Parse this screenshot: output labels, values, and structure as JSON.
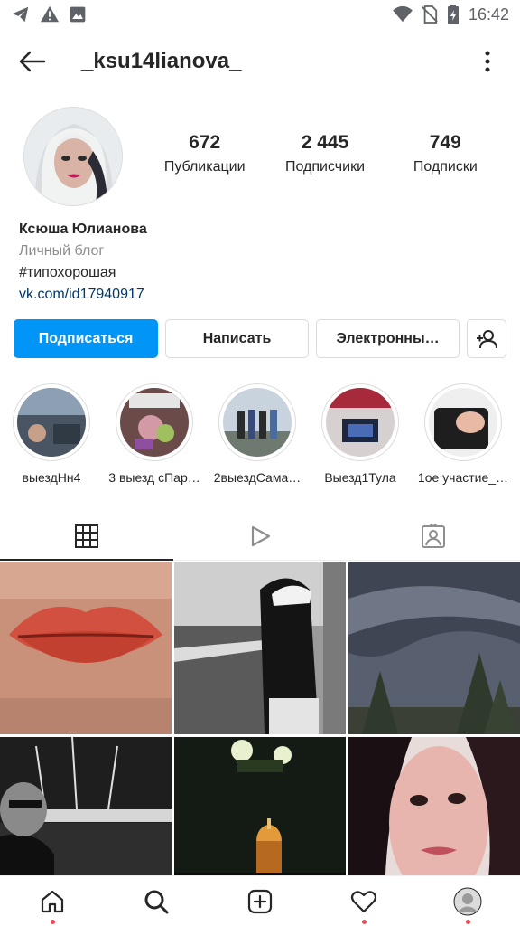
{
  "status_bar": {
    "time": "16:42",
    "left_icons": [
      "telegram-icon",
      "warning-icon",
      "image-icon"
    ],
    "right_icons": [
      "wifi-icon",
      "no-sim-icon",
      "battery-icon"
    ]
  },
  "header": {
    "username": "_ksu14lianova_"
  },
  "stats": [
    {
      "value": "672",
      "label": "Публикации"
    },
    {
      "value": "2 445",
      "label": "Подписчики"
    },
    {
      "value": "749",
      "label": "Подписки"
    }
  ],
  "bio": {
    "name": "Ксюша Юлианова",
    "category": "Личный блог",
    "text": "#типохорошая",
    "link": "vk.com/id17940917"
  },
  "actions": {
    "follow": "Подписаться",
    "message": "Написать",
    "email": "Электронны…"
  },
  "highlights": [
    {
      "label": "выездНн4"
    },
    {
      "label": "3 выезд сПар…"
    },
    {
      "label": "2выездСама…"
    },
    {
      "label": "Выезд1Тула"
    },
    {
      "label": "1ое участие_…"
    }
  ],
  "tabs": [
    "grid-icon",
    "reels-icon",
    "tagged-icon"
  ],
  "bottom_nav": [
    "home-icon",
    "search-icon",
    "add-post-icon",
    "activity-icon",
    "profile-avatar"
  ],
  "colors": {
    "primary_button": "#0095f6",
    "link": "#00376b",
    "notification_dot": "#ed4956"
  }
}
